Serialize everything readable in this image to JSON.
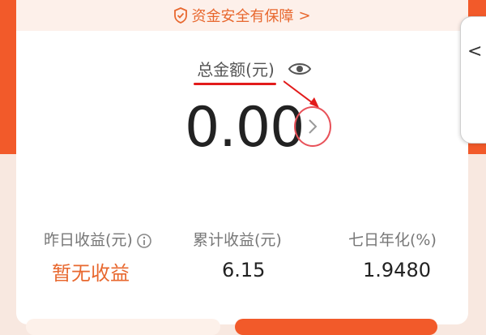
{
  "banner": {
    "text": "资金安全有保障",
    "chevron": ">"
  },
  "total": {
    "label": "总金额(元)",
    "amount": "0.00"
  },
  "stats": [
    {
      "label": "昨日收益(元)",
      "value": "暂无收益",
      "value_color": "#e8682f",
      "has_info_icon": true
    },
    {
      "label": "累计收益(元)",
      "value": "6.15"
    },
    {
      "label": "七日年化(%)",
      "value": "1.9480"
    }
  ],
  "side_panel": {
    "chevron": "<"
  },
  "colors": {
    "accent": "#f25a2a",
    "annotation": "#e21b1b",
    "banner_text": "#e8682f"
  },
  "icons": [
    "shield-check-icon",
    "eye-icon",
    "chevron-right-icon",
    "info-icon",
    "chevron-left-icon"
  ]
}
